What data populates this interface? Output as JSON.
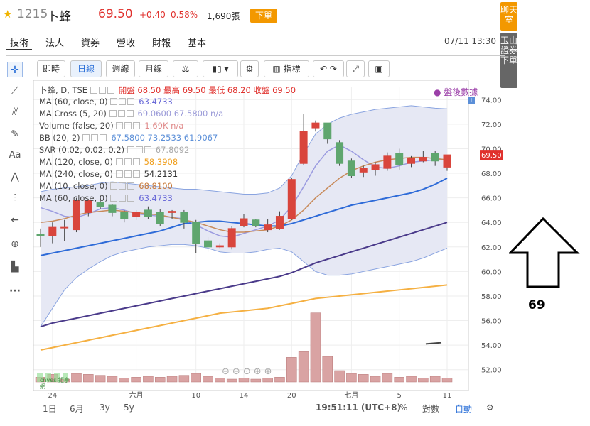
{
  "header": {
    "code": "1215",
    "name": "卜蜂",
    "price": "69.50",
    "change": "+0.40",
    "change_pct": "0.58%",
    "volume": "1,690張",
    "trade_button": "下單",
    "timestamp": "07/11 13:30",
    "up_color": "#e0312d"
  },
  "tabs": [
    "技術",
    "法人",
    "資券",
    "營收",
    "財報",
    "基本"
  ],
  "side_buttons": {
    "chat": "聊天室",
    "order": "玉山證券下單"
  },
  "toolbar": {
    "intraday": "即時",
    "daily": "日線",
    "weekly": "週線",
    "monthly": "月線",
    "indicators": "指標"
  },
  "left_tools": [
    "crosshair-icon",
    "line-icon",
    "fib-icon",
    "brush-icon",
    "text-icon",
    "pattern-icon",
    "measure-icon",
    "arrow-icon",
    "zoom-icon",
    "ruler-icon",
    "more-icon"
  ],
  "studies": [
    {
      "label": "卜蜂, D, TSE",
      "values": "開盤 68.50 最高 69.50 最低 68.20 收盤 69.50",
      "color": "#e0312d"
    },
    {
      "label": "MA (60, close, 0)",
      "values": "63.4733",
      "color": "#6b6bd8"
    },
    {
      "label": "MA Cross (5, 20)",
      "values": "69.0600 67.5800 n/a",
      "color": "#9b9bd8"
    },
    {
      "label": "Volume (false, 20)",
      "values": "1.69K n/a",
      "color": "#e08a8a"
    },
    {
      "label": "BB (20, 2)",
      "values": "67.5800 73.2533 61.9067",
      "color": "#5b8fd8"
    },
    {
      "label": "SAR (0.02, 0.02, 0.2)",
      "values": "67.8092",
      "color": "#aaaaaa"
    },
    {
      "label": "MA (120, close, 0)",
      "values": "58.3908",
      "color": "#f0a020"
    },
    {
      "label": "MA (240, close, 0)",
      "values": "54.2131",
      "color": "#333333"
    },
    {
      "label": "MA (10, close, 0)",
      "values": "68.8100",
      "color": "#c87a3a"
    },
    {
      "label": "MA (60, close, 0)",
      "values": "63.4733",
      "color": "#6b6bd8"
    }
  ],
  "after_hours": "盤後數據",
  "bottom": {
    "ranges": [
      "1日",
      "6月",
      "3y",
      "5y"
    ],
    "clock": "19:51:11 (UTC+8)",
    "pct": "%",
    "log": "對數",
    "auto": "自動"
  },
  "brand": "cnyes 鉅亨網",
  "annotation": "69",
  "chart_data": {
    "type": "candlestick",
    "ylim": [
      51,
      75
    ],
    "y_ticks": [
      52,
      54,
      56,
      58,
      60,
      62,
      64,
      66,
      68,
      70,
      72,
      74
    ],
    "x_tick_labels": [
      "24",
      "六月",
      "10",
      "14",
      "20",
      "七月",
      "5",
      "11"
    ],
    "last_price_label": "69.50",
    "candles": [
      {
        "o": 63.0,
        "h": 63.5,
        "l": 62.0,
        "c": 62.9
      },
      {
        "o": 62.9,
        "h": 64.0,
        "l": 62.3,
        "c": 63.6
      },
      {
        "o": 63.6,
        "h": 64.2,
        "l": 62.5,
        "c": 63.6
      },
      {
        "o": 63.4,
        "h": 66.0,
        "l": 63.2,
        "c": 65.8
      },
      {
        "o": 64.8,
        "h": 65.9,
        "l": 64.5,
        "c": 65.8
      },
      {
        "o": 65.6,
        "h": 66.0,
        "l": 65.1,
        "c": 65.3
      },
      {
        "o": 65.4,
        "h": 65.5,
        "l": 64.5,
        "c": 64.8
      },
      {
        "o": 64.8,
        "h": 65.0,
        "l": 64.0,
        "c": 64.3
      },
      {
        "o": 64.5,
        "h": 65.0,
        "l": 64.2,
        "c": 64.8
      },
      {
        "o": 65.0,
        "h": 65.3,
        "l": 64.3,
        "c": 64.5
      },
      {
        "o": 64.8,
        "h": 65.1,
        "l": 63.7,
        "c": 63.9
      },
      {
        "o": 64.8,
        "h": 65.0,
        "l": 64.3,
        "c": 64.9
      },
      {
        "o": 64.8,
        "h": 65.0,
        "l": 63.5,
        "c": 64.0
      },
      {
        "o": 64.0,
        "h": 64.2,
        "l": 61.5,
        "c": 62.3
      },
      {
        "o": 62.5,
        "h": 62.8,
        "l": 61.6,
        "c": 62.0
      },
      {
        "o": 62.0,
        "h": 62.3,
        "l": 61.9,
        "c": 62.1
      },
      {
        "o": 62.0,
        "h": 63.7,
        "l": 61.8,
        "c": 63.5
      },
      {
        "o": 63.7,
        "h": 64.7,
        "l": 63.6,
        "c": 64.3
      },
      {
        "o": 64.2,
        "h": 64.3,
        "l": 63.6,
        "c": 63.7
      },
      {
        "o": 63.4,
        "h": 64.3,
        "l": 63.2,
        "c": 63.8
      },
      {
        "o": 63.5,
        "h": 64.9,
        "l": 63.4,
        "c": 64.5
      },
      {
        "o": 64.3,
        "h": 67.6,
        "l": 64.2,
        "c": 67.5
      },
      {
        "o": 68.8,
        "h": 72.8,
        "l": 68.7,
        "c": 71.4
      },
      {
        "o": 71.7,
        "h": 72.3,
        "l": 71.4,
        "c": 72.1
      },
      {
        "o": 72.1,
        "h": 72.1,
        "l": 70.4,
        "c": 70.8
      },
      {
        "o": 70.5,
        "h": 70.7,
        "l": 68.6,
        "c": 68.8
      },
      {
        "o": 69.0,
        "h": 69.2,
        "l": 67.6,
        "c": 67.8
      },
      {
        "o": 68.1,
        "h": 68.6,
        "l": 67.7,
        "c": 68.4
      },
      {
        "o": 68.3,
        "h": 68.9,
        "l": 67.8,
        "c": 68.7
      },
      {
        "o": 68.4,
        "h": 69.7,
        "l": 68.2,
        "c": 69.4
      },
      {
        "o": 69.6,
        "h": 70.0,
        "l": 68.3,
        "c": 68.7
      },
      {
        "o": 68.8,
        "h": 69.4,
        "l": 68.5,
        "c": 69.2
      },
      {
        "o": 69.0,
        "h": 69.8,
        "l": 68.9,
        "c": 69.3
      },
      {
        "o": 69.6,
        "h": 69.8,
        "l": 68.6,
        "c": 69.0
      },
      {
        "o": 68.5,
        "h": 69.5,
        "l": 68.2,
        "c": 69.5
      }
    ],
    "volume": [
      0.5,
      0.8,
      0.3,
      0.9,
      0.8,
      0.7,
      0.6,
      0.4,
      0.5,
      0.6,
      0.5,
      0.6,
      0.7,
      0.9,
      0.6,
      0.4,
      0.3,
      0.4,
      0.3,
      0.4,
      0.5,
      2.6,
      3.2,
      7.3,
      2.7,
      1.2,
      0.9,
      0.8,
      0.6,
      0.9,
      0.5,
      0.6,
      0.4,
      0.6,
      0.4
    ],
    "ma60": [
      61.3,
      61.5,
      61.7,
      61.9,
      62.1,
      62.3,
      62.5,
      62.7,
      62.9,
      63.1,
      63.3,
      63.6,
      63.9,
      64.0,
      64.1,
      64.1,
      64.0,
      63.9,
      63.8,
      63.7,
      63.7,
      63.9,
      64.2,
      64.5,
      64.8,
      65.1,
      65.4,
      65.6,
      65.8,
      66.0,
      66.2,
      66.4,
      66.7,
      67.1,
      67.6
    ],
    "ma240": [
      55.5,
      55.8,
      56.0,
      56.2,
      56.4,
      56.6,
      56.8,
      57.0,
      57.2,
      57.4,
      57.6,
      57.8,
      58.0,
      58.2,
      58.4,
      58.6,
      58.8,
      59.0,
      59.2,
      59.4,
      59.6,
      59.9,
      60.3,
      60.7,
      61.0,
      61.3,
      61.6,
      61.9,
      62.2,
      62.5,
      62.8,
      63.1,
      63.4,
      63.7,
      64.0
    ],
    "ma120": [
      53.6,
      53.8,
      54.0,
      54.2,
      54.4,
      54.6,
      54.8,
      55.0,
      55.2,
      55.4,
      55.6,
      55.8,
      56.0,
      56.2,
      56.4,
      56.6,
      56.7,
      56.8,
      56.9,
      57.0,
      57.2,
      57.4,
      57.6,
      57.8,
      57.9,
      58.0,
      58.1,
      58.2,
      58.3,
      58.4,
      58.5,
      58.6,
      58.7,
      58.8,
      58.9
    ],
    "ma10": [
      64.0,
      64.1,
      64.3,
      64.6,
      64.8,
      64.9,
      65.0,
      64.9,
      64.8,
      64.7,
      64.6,
      64.4,
      64.2,
      64.0,
      63.7,
      63.4,
      63.2,
      63.2,
      63.3,
      63.4,
      63.7,
      64.2,
      65.0,
      66.0,
      66.8,
      67.6,
      68.2,
      68.6,
      68.9,
      69.1,
      69.2,
      69.3,
      69.3,
      69.2,
      69.1
    ],
    "ma5": [
      65.2,
      64.9,
      64.5,
      64.4,
      64.7,
      65.1,
      65.2,
      65.0,
      64.7,
      64.6,
      64.5,
      64.4,
      64.3,
      63.8,
      63.3,
      62.9,
      62.8,
      63.1,
      63.4,
      63.7,
      64.2,
      65.3,
      66.9,
      68.6,
      69.8,
      70.3,
      69.8,
      69.1,
      68.5,
      68.4,
      68.6,
      68.9,
      69.0,
      69.1,
      69.1
    ],
    "bb_upper": [
      66.5,
      66.7,
      66.8,
      66.9,
      67.0,
      67.2,
      67.3,
      67.2,
      67.1,
      67.0,
      66.9,
      66.8,
      66.7,
      66.7,
      66.6,
      66.5,
      66.4,
      66.3,
      66.3,
      66.4,
      66.8,
      67.8,
      69.6,
      71.2,
      72.0,
      72.5,
      72.8,
      73.0,
      73.2,
      73.3,
      73.4,
      73.5,
      73.4,
      73.3,
      73.25
    ],
    "bb_lower": [
      55.5,
      57.0,
      58.5,
      59.5,
      60.2,
      60.8,
      61.3,
      61.6,
      61.8,
      62.0,
      62.1,
      62.2,
      62.2,
      62.1,
      61.9,
      61.6,
      61.5,
      61.5,
      61.6,
      61.8,
      61.9,
      61.6,
      60.8,
      60.0,
      59.7,
      59.7,
      59.8,
      60.0,
      60.2,
      60.4,
      60.6,
      60.8,
      61.1,
      61.5,
      61.9
    ]
  }
}
